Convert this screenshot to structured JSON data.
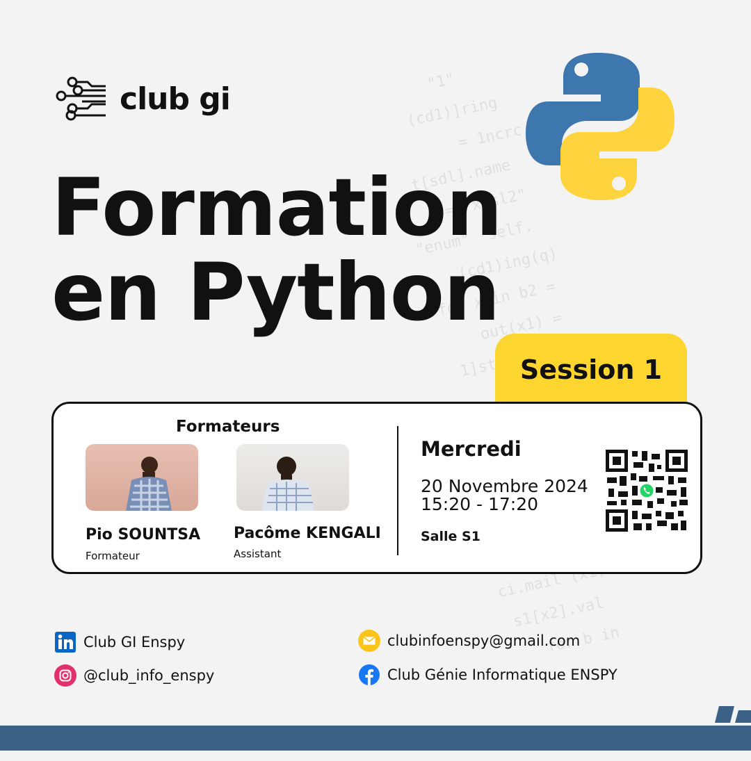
{
  "club": {
    "logo_text": "club gi"
  },
  "title": {
    "line1": "Formation",
    "line2": "en Python"
  },
  "session": {
    "label": "Session 1"
  },
  "card": {
    "formateurs_title": "Formateurs",
    "people": [
      {
        "name": "Pio SOUNTSA",
        "role": "Formateur"
      },
      {
        "name": "Pacôme KENGALI",
        "role": "Assistant"
      }
    ],
    "day": "Mercredi",
    "date": "20 Novembre 2024",
    "time": "15:20 - 17:20",
    "room": "Salle S1"
  },
  "contacts": {
    "linkedin": "Club GI Enspy",
    "instagram": "@club_info_enspy",
    "email": "clubinfoenspy@gmail.com",
    "facebook": "Club Génie Informatique ENSPY"
  },
  "icons": {
    "logo": "circuit-icon",
    "linkedin": "linkedin-icon",
    "instagram": "instagram-icon",
    "email": "mail-icon",
    "facebook": "facebook-icon",
    "whatsapp": "whatsapp-icon"
  },
  "colors": {
    "accent_yellow": "#fcd52e",
    "python_blue": "#3d77ad",
    "python_yellow": "#fdd43e",
    "footer_blue": "#3b6186"
  }
}
